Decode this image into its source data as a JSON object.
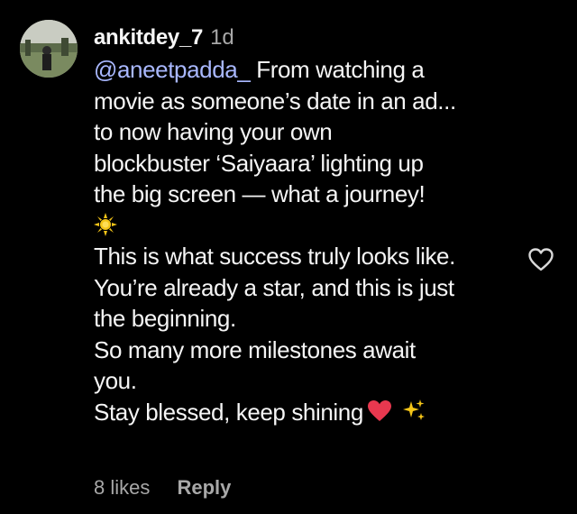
{
  "comment": {
    "username": "ankitdey_7",
    "timestamp": "1d",
    "mention": "@aneetpadda_",
    "lines": [
      " From watching a",
      "movie as someone’s date in an ad...",
      "to now having your own",
      "blockbuster ‘Saiyaara’ lighting up",
      "the big screen — what a journey!",
      "",
      "This is what success truly looks like.",
      "You’re already a star, and this is just",
      "the beginning.",
      "So many more milestones await",
      "you.",
      "Stay blessed, keep shining"
    ],
    "likes_label": "8 likes",
    "reply_label": "Reply"
  },
  "icons": {
    "like": "heart-outline-icon",
    "sun_emoji": "sun-emoji-icon",
    "heart_emoji": "red-heart-emoji-icon",
    "sparkles_emoji": "sparkles-emoji-icon"
  },
  "colors": {
    "background": "#000000",
    "text": "#f5f5f5",
    "muted": "#a8a8a8",
    "mention": "#a9b8ff",
    "heart_emoji": "#e8384f",
    "sparkle": "#f5c518"
  }
}
